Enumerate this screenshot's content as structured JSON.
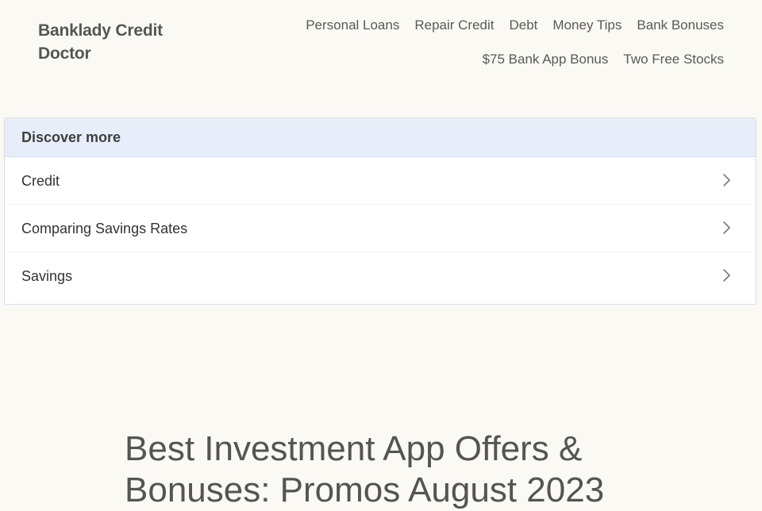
{
  "header": {
    "site_title": "Banklady Credit Doctor",
    "nav_row1": [
      "Personal Loans",
      "Repair Credit",
      "Debt",
      "Money Tips",
      "Bank Bonuses"
    ],
    "nav_row2": [
      "$75 Bank App Bonus",
      "Two Free Stocks"
    ]
  },
  "discover": {
    "heading": "Discover more",
    "items": [
      {
        "label": "Credit",
        "icon": "chevron-right-icon"
      },
      {
        "label": "Comparing Savings Rates",
        "icon": "chevron-right-icon"
      },
      {
        "label": "Savings",
        "icon": "chevron-right-icon"
      }
    ]
  },
  "article": {
    "title": "Best Investment App Offers & Bonuses: Promos August 2023"
  }
}
